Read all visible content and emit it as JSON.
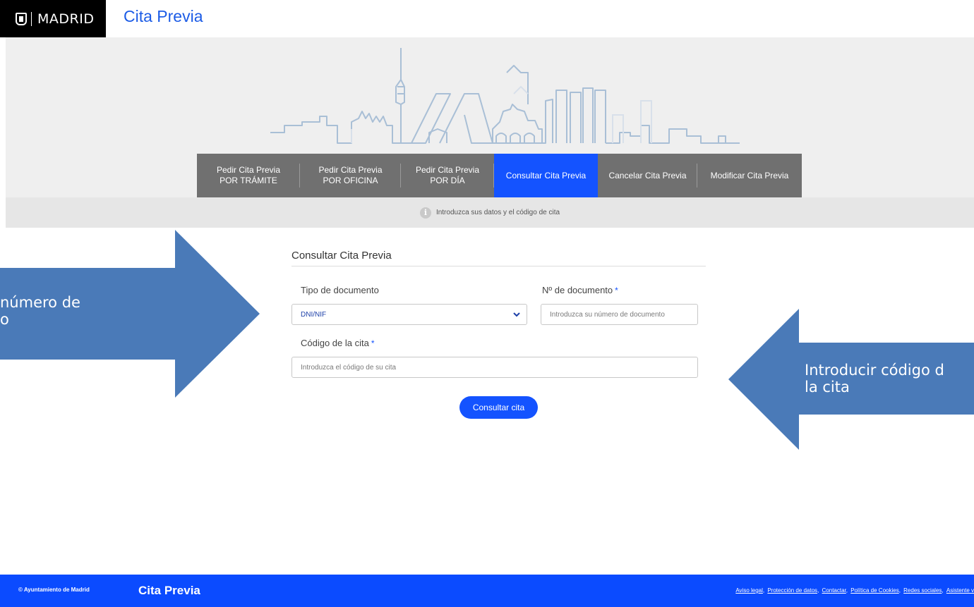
{
  "header": {
    "logo_text": "MADRID",
    "app_title": "Cita Previa"
  },
  "nav": {
    "tabs": [
      {
        "line1": "Pedir Cita Previa",
        "line2": "POR TRÁMITE"
      },
      {
        "line1": "Pedir Cita Previa",
        "line2": "POR OFICINA"
      },
      {
        "line1": "Pedir Cita Previa",
        "line2": "POR DÍA"
      },
      {
        "line1": "Consultar Cita Previa",
        "line2": ""
      },
      {
        "line1": "Cancelar Cita Previa",
        "line2": ""
      },
      {
        "line1": "Modificar Cita Previa",
        "line2": ""
      }
    ],
    "active_index": 3
  },
  "info": {
    "icon": "info-icon",
    "text": "Introduzca sus datos y el código de cita"
  },
  "form": {
    "title": "Consultar Cita Previa",
    "doc_type_label": "Tipo de documento",
    "doc_type_value": "DNI/NIF",
    "doc_number_label": "Nº de documento",
    "doc_number_placeholder": "Introduzca su número de documento",
    "code_label": "Código de la cita",
    "code_placeholder": "Introduzca el código de su cita",
    "required_mark": "*",
    "submit_label": "Consultar cita"
  },
  "annotations": {
    "left_line1": "número de",
    "left_line2": "o",
    "right_line1": "Introducir código d",
    "right_line2": "la cita"
  },
  "footer": {
    "copyright": "© Ayuntamiento de Madrid",
    "brand": "Cita Previa",
    "links": [
      "Aviso legal",
      "Protección de datos",
      "Contactar",
      "Política de Cookies",
      "Redes sociales",
      "Asistente v"
    ]
  },
  "colors": {
    "accent": "#1453ff",
    "nav_bg": "#707070",
    "arrow": "#4a7ab8",
    "footer_bg": "#0b4bff"
  }
}
